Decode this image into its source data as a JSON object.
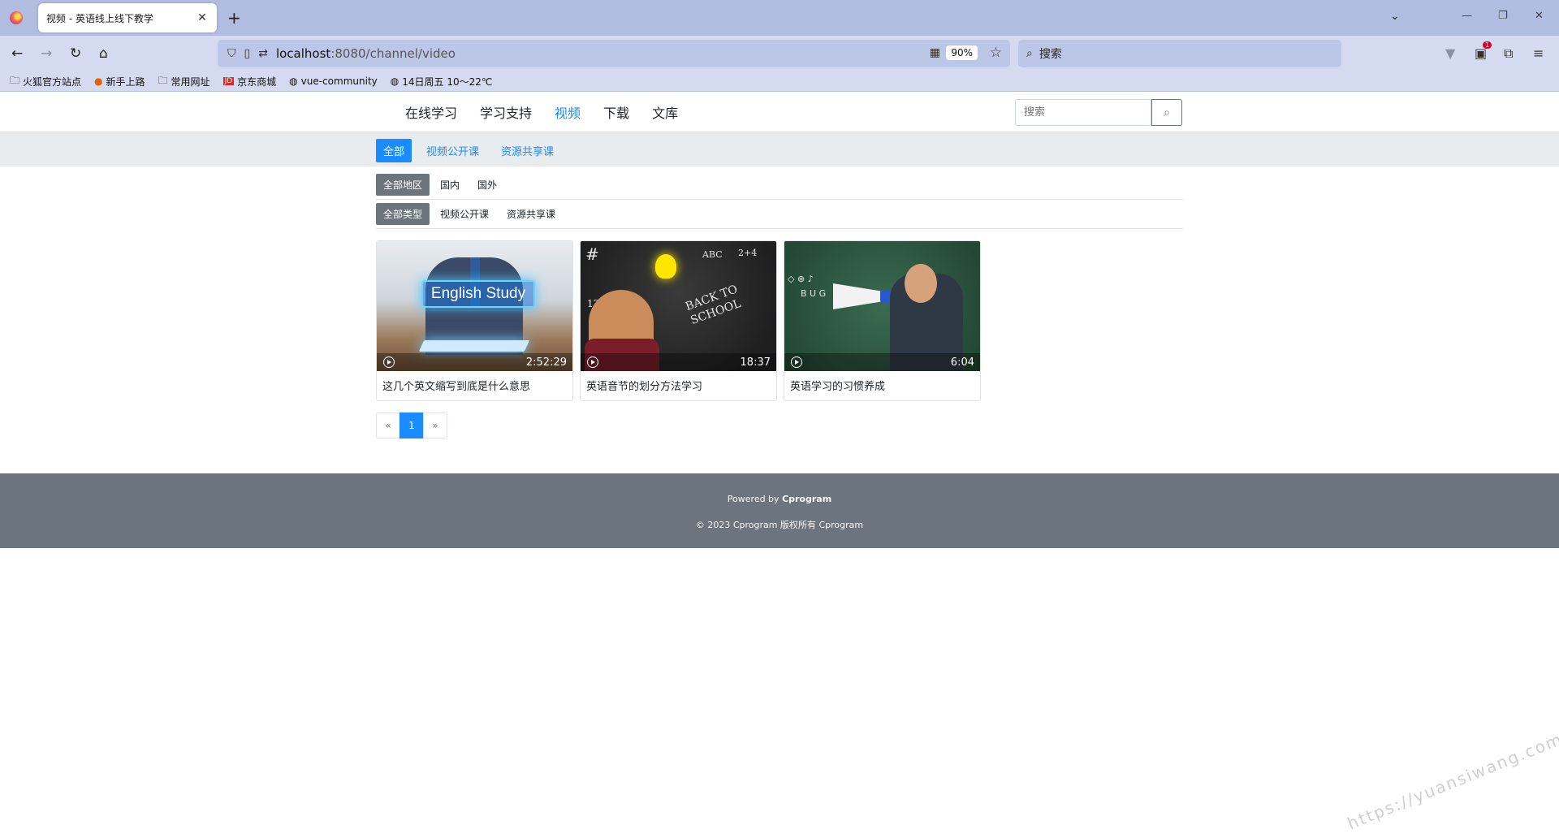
{
  "browser": {
    "tab_title": "视频 - 英语线上线下教学",
    "url_host": "localhost",
    "url_path": ":8080/channel/video",
    "zoom": "90%",
    "search_placeholder": "搜索",
    "bookmarks": [
      {
        "label": "火狐官方站点",
        "icon": "folder-icon"
      },
      {
        "label": "新手上路",
        "icon": "firefox-icon"
      },
      {
        "label": "常用网址",
        "icon": "folder-icon"
      },
      {
        "label": "京东商城",
        "icon": "jd-icon"
      },
      {
        "label": "vue-community",
        "icon": "globe-icon"
      },
      {
        "label": "14日周五  10～22℃",
        "icon": "globe-icon"
      }
    ],
    "ext_badge": "1"
  },
  "nav": {
    "items": [
      "在线学习",
      "学习支持",
      "视频",
      "下载",
      "文库"
    ],
    "active_index": 2,
    "search_placeholder": "搜索"
  },
  "subnav": {
    "items": [
      "全部",
      "视频公开课",
      "资源共享课"
    ],
    "active_index": 0
  },
  "filters": {
    "region": [
      "全部地区",
      "国内",
      "国外"
    ],
    "type": [
      "全部类型",
      "视频公开课",
      "资源共享课"
    ]
  },
  "videos": [
    {
      "title": "这几个英文缩写到底是什么意思",
      "duration": "2:52:29",
      "thumb_text": "English Study"
    },
    {
      "title": "英语音节的划分方法学习",
      "duration": "18:37",
      "thumb_text": "BACK TO SCHOOL"
    },
    {
      "title": "英语学习的习惯养成",
      "duration": "6:04",
      "thumb_text": ""
    }
  ],
  "pagination": {
    "prev": "«",
    "current": "1",
    "next": "»"
  },
  "footer": {
    "powered_prefix": "Powered by ",
    "powered_brand": "Cprogram",
    "copyright": "© 2023 Cprogram 版权所有 Cprogram"
  },
  "watermark": "https://yuansiwang.com",
  "colors": {
    "accent": "#1a8cff",
    "footer_bg": "#6c757d",
    "filter_active": "#6c757d"
  }
}
